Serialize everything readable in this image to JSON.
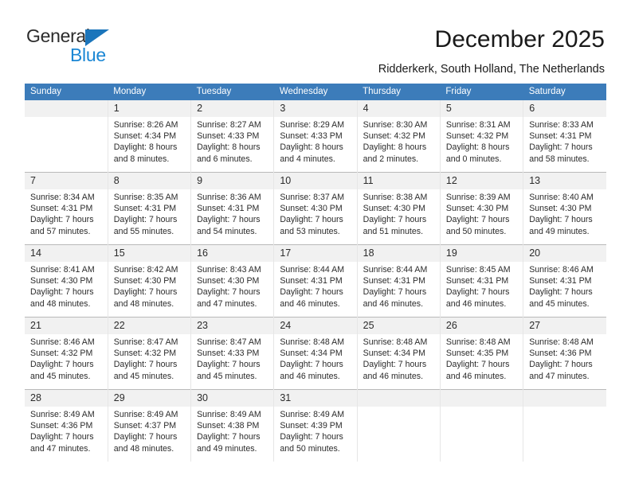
{
  "brand": {
    "name_top": "General",
    "name_bottom": "Blue",
    "accent_color": "#1b75bb",
    "blue_text_color": "#1b87d4"
  },
  "header": {
    "title": "December 2025",
    "subtitle": "Ridderkerk, South Holland, The Netherlands"
  },
  "calendar": {
    "header_bg": "#3c7cba",
    "header_text_color": "#ffffff",
    "daynum_bg": "#f1f1f1",
    "weekdays": [
      "Sunday",
      "Monday",
      "Tuesday",
      "Wednesday",
      "Thursday",
      "Friday",
      "Saturday"
    ],
    "weeks": [
      [
        {
          "day": "",
          "empty": true,
          "sunrise": "",
          "sunset": "",
          "daylight_line1": "",
          "daylight_line2": ""
        },
        {
          "day": "1",
          "sunrise": "Sunrise: 8:26 AM",
          "sunset": "Sunset: 4:34 PM",
          "daylight_line1": "Daylight: 8 hours",
          "daylight_line2": "and 8 minutes."
        },
        {
          "day": "2",
          "sunrise": "Sunrise: 8:27 AM",
          "sunset": "Sunset: 4:33 PM",
          "daylight_line1": "Daylight: 8 hours",
          "daylight_line2": "and 6 minutes."
        },
        {
          "day": "3",
          "sunrise": "Sunrise: 8:29 AM",
          "sunset": "Sunset: 4:33 PM",
          "daylight_line1": "Daylight: 8 hours",
          "daylight_line2": "and 4 minutes."
        },
        {
          "day": "4",
          "sunrise": "Sunrise: 8:30 AM",
          "sunset": "Sunset: 4:32 PM",
          "daylight_line1": "Daylight: 8 hours",
          "daylight_line2": "and 2 minutes."
        },
        {
          "day": "5",
          "sunrise": "Sunrise: 8:31 AM",
          "sunset": "Sunset: 4:32 PM",
          "daylight_line1": "Daylight: 8 hours",
          "daylight_line2": "and 0 minutes."
        },
        {
          "day": "6",
          "sunrise": "Sunrise: 8:33 AM",
          "sunset": "Sunset: 4:31 PM",
          "daylight_line1": "Daylight: 7 hours",
          "daylight_line2": "and 58 minutes."
        }
      ],
      [
        {
          "day": "7",
          "sunrise": "Sunrise: 8:34 AM",
          "sunset": "Sunset: 4:31 PM",
          "daylight_line1": "Daylight: 7 hours",
          "daylight_line2": "and 57 minutes."
        },
        {
          "day": "8",
          "sunrise": "Sunrise: 8:35 AM",
          "sunset": "Sunset: 4:31 PM",
          "daylight_line1": "Daylight: 7 hours",
          "daylight_line2": "and 55 minutes."
        },
        {
          "day": "9",
          "sunrise": "Sunrise: 8:36 AM",
          "sunset": "Sunset: 4:31 PM",
          "daylight_line1": "Daylight: 7 hours",
          "daylight_line2": "and 54 minutes."
        },
        {
          "day": "10",
          "sunrise": "Sunrise: 8:37 AM",
          "sunset": "Sunset: 4:30 PM",
          "daylight_line1": "Daylight: 7 hours",
          "daylight_line2": "and 53 minutes."
        },
        {
          "day": "11",
          "sunrise": "Sunrise: 8:38 AM",
          "sunset": "Sunset: 4:30 PM",
          "daylight_line1": "Daylight: 7 hours",
          "daylight_line2": "and 51 minutes."
        },
        {
          "day": "12",
          "sunrise": "Sunrise: 8:39 AM",
          "sunset": "Sunset: 4:30 PM",
          "daylight_line1": "Daylight: 7 hours",
          "daylight_line2": "and 50 minutes."
        },
        {
          "day": "13",
          "sunrise": "Sunrise: 8:40 AM",
          "sunset": "Sunset: 4:30 PM",
          "daylight_line1": "Daylight: 7 hours",
          "daylight_line2": "and 49 minutes."
        }
      ],
      [
        {
          "day": "14",
          "sunrise": "Sunrise: 8:41 AM",
          "sunset": "Sunset: 4:30 PM",
          "daylight_line1": "Daylight: 7 hours",
          "daylight_line2": "and 48 minutes."
        },
        {
          "day": "15",
          "sunrise": "Sunrise: 8:42 AM",
          "sunset": "Sunset: 4:30 PM",
          "daylight_line1": "Daylight: 7 hours",
          "daylight_line2": "and 48 minutes."
        },
        {
          "day": "16",
          "sunrise": "Sunrise: 8:43 AM",
          "sunset": "Sunset: 4:30 PM",
          "daylight_line1": "Daylight: 7 hours",
          "daylight_line2": "and 47 minutes."
        },
        {
          "day": "17",
          "sunrise": "Sunrise: 8:44 AM",
          "sunset": "Sunset: 4:31 PM",
          "daylight_line1": "Daylight: 7 hours",
          "daylight_line2": "and 46 minutes."
        },
        {
          "day": "18",
          "sunrise": "Sunrise: 8:44 AM",
          "sunset": "Sunset: 4:31 PM",
          "daylight_line1": "Daylight: 7 hours",
          "daylight_line2": "and 46 minutes."
        },
        {
          "day": "19",
          "sunrise": "Sunrise: 8:45 AM",
          "sunset": "Sunset: 4:31 PM",
          "daylight_line1": "Daylight: 7 hours",
          "daylight_line2": "and 46 minutes."
        },
        {
          "day": "20",
          "sunrise": "Sunrise: 8:46 AM",
          "sunset": "Sunset: 4:31 PM",
          "daylight_line1": "Daylight: 7 hours",
          "daylight_line2": "and 45 minutes."
        }
      ],
      [
        {
          "day": "21",
          "sunrise": "Sunrise: 8:46 AM",
          "sunset": "Sunset: 4:32 PM",
          "daylight_line1": "Daylight: 7 hours",
          "daylight_line2": "and 45 minutes."
        },
        {
          "day": "22",
          "sunrise": "Sunrise: 8:47 AM",
          "sunset": "Sunset: 4:32 PM",
          "daylight_line1": "Daylight: 7 hours",
          "daylight_line2": "and 45 minutes."
        },
        {
          "day": "23",
          "sunrise": "Sunrise: 8:47 AM",
          "sunset": "Sunset: 4:33 PM",
          "daylight_line1": "Daylight: 7 hours",
          "daylight_line2": "and 45 minutes."
        },
        {
          "day": "24",
          "sunrise": "Sunrise: 8:48 AM",
          "sunset": "Sunset: 4:34 PM",
          "daylight_line1": "Daylight: 7 hours",
          "daylight_line2": "and 46 minutes."
        },
        {
          "day": "25",
          "sunrise": "Sunrise: 8:48 AM",
          "sunset": "Sunset: 4:34 PM",
          "daylight_line1": "Daylight: 7 hours",
          "daylight_line2": "and 46 minutes."
        },
        {
          "day": "26",
          "sunrise": "Sunrise: 8:48 AM",
          "sunset": "Sunset: 4:35 PM",
          "daylight_line1": "Daylight: 7 hours",
          "daylight_line2": "and 46 minutes."
        },
        {
          "day": "27",
          "sunrise": "Sunrise: 8:48 AM",
          "sunset": "Sunset: 4:36 PM",
          "daylight_line1": "Daylight: 7 hours",
          "daylight_line2": "and 47 minutes."
        }
      ],
      [
        {
          "day": "28",
          "sunrise": "Sunrise: 8:49 AM",
          "sunset": "Sunset: 4:36 PM",
          "daylight_line1": "Daylight: 7 hours",
          "daylight_line2": "and 47 minutes."
        },
        {
          "day": "29",
          "sunrise": "Sunrise: 8:49 AM",
          "sunset": "Sunset: 4:37 PM",
          "daylight_line1": "Daylight: 7 hours",
          "daylight_line2": "and 48 minutes."
        },
        {
          "day": "30",
          "sunrise": "Sunrise: 8:49 AM",
          "sunset": "Sunset: 4:38 PM",
          "daylight_line1": "Daylight: 7 hours",
          "daylight_line2": "and 49 minutes."
        },
        {
          "day": "31",
          "sunrise": "Sunrise: 8:49 AM",
          "sunset": "Sunset: 4:39 PM",
          "daylight_line1": "Daylight: 7 hours",
          "daylight_line2": "and 50 minutes."
        },
        {
          "day": "",
          "empty": true,
          "sunrise": "",
          "sunset": "",
          "daylight_line1": "",
          "daylight_line2": ""
        },
        {
          "day": "",
          "empty": true,
          "sunrise": "",
          "sunset": "",
          "daylight_line1": "",
          "daylight_line2": ""
        },
        {
          "day": "",
          "empty": true,
          "sunrise": "",
          "sunset": "",
          "daylight_line1": "",
          "daylight_line2": ""
        }
      ]
    ]
  }
}
